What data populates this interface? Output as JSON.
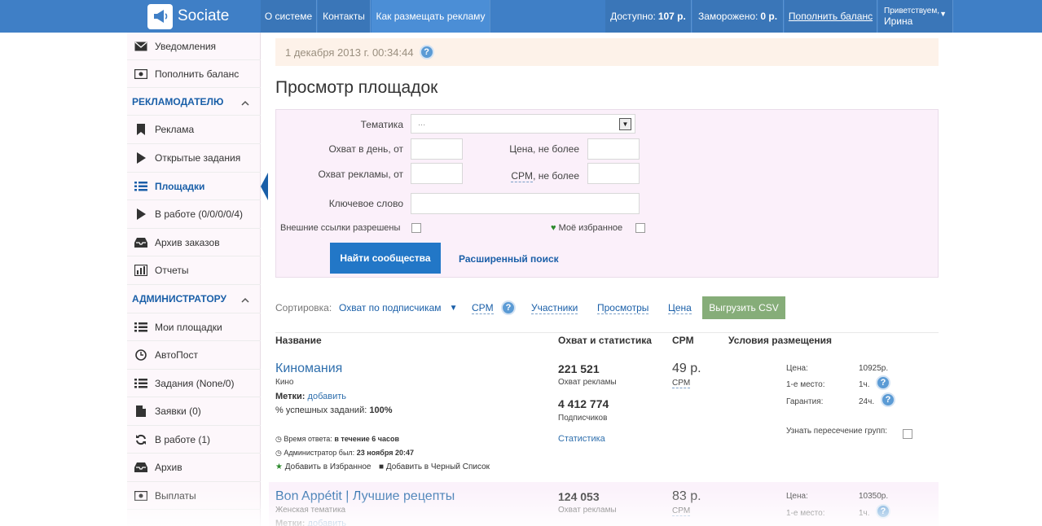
{
  "app": {
    "name": "Sociate"
  },
  "topnav": {
    "about": "О системе",
    "contacts": "Контакты",
    "how_to": "Как размещать рекламу",
    "available_label": "Доступно:",
    "available_value": "107 р.",
    "frozen_label": "Заморожено:",
    "frozen_value": "0 р.",
    "topup": "Пополнить баланс",
    "greeting": "Приветствуем,",
    "user": "Ирина"
  },
  "sidebar": {
    "notifications": "Уведомления",
    "topup": "Пополнить баланс",
    "advertiser_section": "РЕКЛАМОДАТЕЛЮ",
    "ads": "Реклама",
    "open_tasks": "Открытые задания",
    "platforms": "Площадки",
    "in_work": "В работе (0/0/0/0/4)",
    "orders_archive": "Архив заказов",
    "reports": "Отчеты",
    "admin_section": "АДМИНИСТРАТОРУ",
    "my_platforms": "Мои площадки",
    "autopost": "АвтоПост",
    "tasks": "Задания (None/0)",
    "requests": "Заявки (0)",
    "admin_in_work": "В работе (1)",
    "archive": "Архив",
    "payouts": "Выплаты"
  },
  "datebar": {
    "text": "1 декабря 2013 г. 00:34:44"
  },
  "page": {
    "title": "Просмотр площадок"
  },
  "filter": {
    "topic_label": "Тематика",
    "topic_value": "...",
    "reach_day_label": "Охват в день, от",
    "price_label": "Цена, не более",
    "reach_ad_label": "Охват рекламы, от",
    "cpm_label": "CPM",
    "cpm_suffix": ", не более",
    "keyword_label": "Ключевое слово",
    "external_links_label": "Внешние ссылки разрешены",
    "favorites_label": "Моё избранное",
    "find_button": "Найти сообщества",
    "advanced_search": "Расширенный поиск"
  },
  "sort": {
    "label": "Сортировка:",
    "by_subscribers": "Охват по подписчикам",
    "cpm": "CPM",
    "members": "Участники",
    "views": "Просмотры",
    "price": "Цена",
    "export_csv": "Выгрузить CSV"
  },
  "table": {
    "headers": [
      "Название",
      "Охват и статистика",
      "CPM",
      "Условия размещения"
    ],
    "rows": [
      {
        "name": "Киномания",
        "category": "Кино",
        "tags_label": "Метки:",
        "tags_add": "добавить",
        "success_label": "% успешных заданий:",
        "success_value": "100%",
        "response_label": "Время ответа:",
        "response_value": "в течение 6 часов",
        "admin_seen_label": "Администратор был:",
        "admin_seen_value": "23 ноября 20:47",
        "add_favorites": "Добавить в Избранное",
        "add_blacklist": "Добавить в Черный Список",
        "reach": "221 521",
        "reach_caption": "Охват рекламы",
        "subscribers": "4 412 774",
        "subscribers_caption": "Подписчиков",
        "stats_link": "Статистика",
        "cpm": "49 р.",
        "cpm_caption": "CPM",
        "price_label": "Цена:",
        "price_value": "10925р.",
        "first_place_label": "1-е место:",
        "first_place_value": "1ч.",
        "guarantee_label": "Гарантия:",
        "guarantee_value": "24ч.",
        "intersection_label": "Узнать пересечение групп:"
      },
      {
        "name": "Bon Appétit | Лучшие рецепты",
        "category": "Женская тематика",
        "tags_label": "Метки:",
        "tags_add": "добавить",
        "reach": "124 053",
        "reach_caption": "Охват рекламы",
        "cpm": "83 р.",
        "cpm_caption": "CPM",
        "price_label": "Цена:",
        "price_value": "10350р.",
        "first_place_label": "1-е место:",
        "first_place_value": "1ч."
      }
    ]
  },
  "icons": {
    "help": "?"
  },
  "colors": {
    "topbar": "#3f7fc6",
    "accent": "#1a5fa8",
    "find_button": "#2277c7",
    "csv_button": "#86ad79"
  }
}
